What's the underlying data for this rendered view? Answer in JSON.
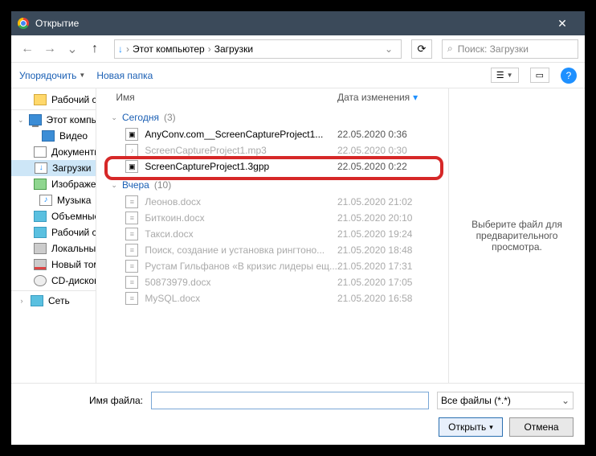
{
  "window": {
    "title": "Открытие",
    "close": "✕"
  },
  "nav": {
    "breadcrumb": {
      "root": "Этот компьютер",
      "sep": "›",
      "current": "Загрузки",
      "drop": "⌄"
    },
    "refresh": "⟳"
  },
  "search": {
    "placeholder": "Поиск: Загрузки",
    "icon": "⌕"
  },
  "toolbar": {
    "organize": "Упорядочить",
    "new_folder": "Новая папка",
    "view_label": "☰",
    "preview_label": "▭",
    "help": "?"
  },
  "sidebar": {
    "items": [
      {
        "label": "Рабочий стол",
        "icon": "icon-folder",
        "lvl": 1
      },
      {
        "label": "Этот компьютер",
        "icon": "icon-pc",
        "lvl": 0,
        "expanded": true
      },
      {
        "label": "Видео",
        "icon": "icon-video",
        "lvl": 1
      },
      {
        "label": "Документы",
        "icon": "icon-doc",
        "lvl": 1
      },
      {
        "label": "Загрузки",
        "icon": "icon-download",
        "lvl": 1,
        "selected": true
      },
      {
        "label": "Изображения",
        "icon": "icon-image",
        "lvl": 1
      },
      {
        "label": "Музыка",
        "icon": "icon-music",
        "lvl": 1
      },
      {
        "label": "Объемные объ",
        "icon": "icon-3d",
        "lvl": 1
      },
      {
        "label": "Рабочий стол",
        "icon": "icon-desktop",
        "lvl": 1
      },
      {
        "label": "Локальный дис",
        "icon": "icon-disk",
        "lvl": 1
      },
      {
        "label": "Новый том (D:)",
        "icon": "icon-disk-red",
        "lvl": 1
      },
      {
        "label": "CD-дисковод (F:",
        "icon": "icon-cd",
        "lvl": 1
      },
      {
        "label": "Сеть",
        "icon": "icon-network",
        "lvl": 0
      }
    ]
  },
  "columns": {
    "name": "Имя",
    "date": "Дата изменения"
  },
  "groups": [
    {
      "label": "Сегодня",
      "count": "(3)",
      "files": [
        {
          "name": "AnyConv.com__ScreenCaptureProject1...",
          "date": "22.05.2020 0:36",
          "dimmed": false,
          "icon": "▣"
        },
        {
          "name": "ScreenCaptureProject1.mp3",
          "date": "22.05.2020 0:30",
          "dimmed": true,
          "icon": "♪"
        },
        {
          "name": "ScreenCaptureProject1.3gpp",
          "date": "22.05.2020 0:22",
          "dimmed": false,
          "icon": "▣"
        }
      ]
    },
    {
      "label": "Вчера",
      "count": "(10)",
      "files": [
        {
          "name": "Леонов.docx",
          "date": "21.05.2020 21:02",
          "dimmed": true,
          "icon": "≡"
        },
        {
          "name": "Биткоин.docx",
          "date": "21.05.2020 20:10",
          "dimmed": true,
          "icon": "≡"
        },
        {
          "name": "Такси.docx",
          "date": "21.05.2020 19:24",
          "dimmed": true,
          "icon": "≡"
        },
        {
          "name": "Поиск, создание и установка рингтоно...",
          "date": "21.05.2020 18:48",
          "dimmed": true,
          "icon": "≡"
        },
        {
          "name": "Рустам Гильфанов «В кризис лидеры ещ...",
          "date": "21.05.2020 17:31",
          "dimmed": true,
          "icon": "≡"
        },
        {
          "name": "50873979.docx",
          "date": "21.05.2020 17:05",
          "dimmed": true,
          "icon": "≡"
        },
        {
          "name": "MySQL.docx",
          "date": "21.05.2020 16:58",
          "dimmed": true,
          "icon": "≡"
        }
      ]
    }
  ],
  "preview": {
    "text": "Выберите файл для предварительного просмотра."
  },
  "footer": {
    "filename_label": "Имя файла:",
    "filename_value": "",
    "filetype": "Все файлы (*.*)",
    "open": "Открыть",
    "cancel": "Отмена"
  }
}
